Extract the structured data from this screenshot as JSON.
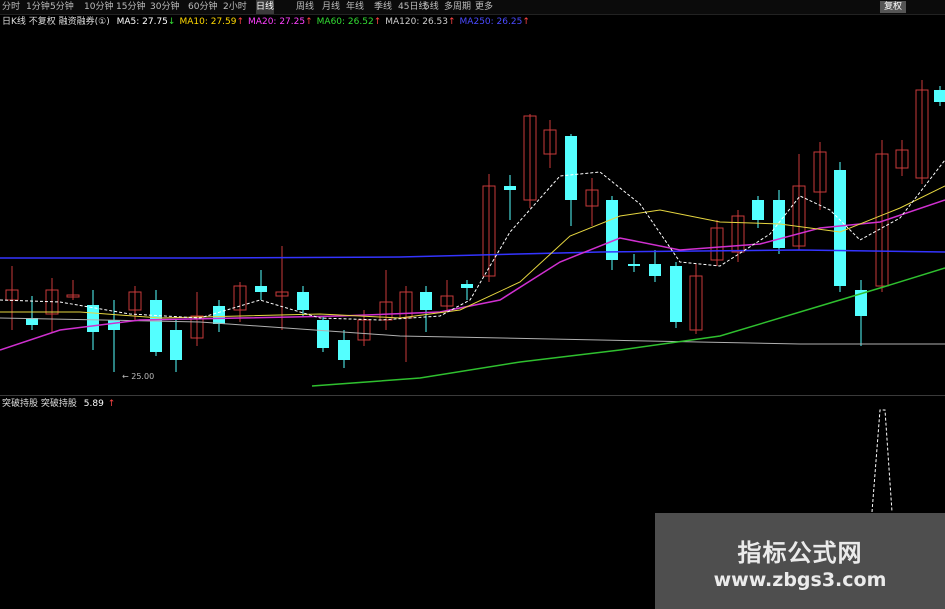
{
  "toolbar": {
    "items": [
      "分时",
      "1分钟",
      "5分钟",
      "10分钟",
      "15分钟",
      "30分钟",
      "60分钟",
      "2小时",
      "日线",
      "周线",
      "月线",
      "年线",
      "季线",
      "45日线",
      "5线",
      "多周期",
      "更多"
    ],
    "active_index": 8,
    "right_button": "复权"
  },
  "ma_bar": {
    "label": "日K线 不复权 融资融券(①)",
    "items": [
      {
        "text": "MA5: 27.75",
        "arrow": "↓",
        "color": "#ffffff"
      },
      {
        "text": "MA10: 27.59",
        "arrow": "↑",
        "color": "#ffd800"
      },
      {
        "text": "MA20: 27.25",
        "arrow": "↑",
        "color": "#ff40ff"
      },
      {
        "text": "MA60: 26.52",
        "arrow": "↑",
        "color": "#33dd33"
      },
      {
        "text": "MA120: 26.53",
        "arrow": "↑",
        "color": "#cccccc"
      },
      {
        "text": "MA250: 26.25",
        "arrow": "↑",
        "color": "#4a4aff"
      }
    ]
  },
  "indicator_bar": {
    "label": "突破持股 突破持股",
    "value": "5.89",
    "arrow": "↑"
  },
  "price_low_label": "25.00",
  "watermark": {
    "title": "指标公式网",
    "url": "www.zbgs3.com"
  },
  "colors": {
    "up": "#ff4444",
    "down": "#54ffff",
    "background": "#000000"
  }
}
